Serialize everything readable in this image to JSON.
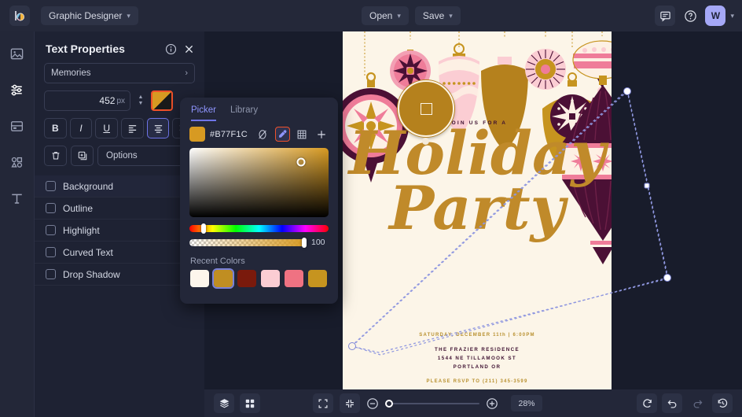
{
  "app": {
    "logo_icon": "color-wheel-logo",
    "document_name": "Graphic Designer"
  },
  "topbar": {
    "open_label": "Open",
    "save_label": "Save",
    "comment_icon": "comment-icon",
    "help_icon": "help-circle-icon",
    "avatar_initial": "W",
    "account_caret": "chevron-down-icon"
  },
  "rail": {
    "items": [
      {
        "icon": "image-icon",
        "name": "images"
      },
      {
        "icon": "sliders-icon",
        "name": "adjustments"
      },
      {
        "icon": "frame-icon",
        "name": "layouts"
      },
      {
        "icon": "shapes-icon",
        "name": "shapes"
      },
      {
        "icon": "text-icon",
        "name": "text"
      }
    ]
  },
  "panel": {
    "title": "Text Properties",
    "info_icon": "info-icon",
    "close_icon": "close-icon",
    "font_select": "Memories",
    "font_chevron": "chevron-right-icon",
    "size_value": "452",
    "size_unit": "px",
    "format_buttons": [
      {
        "label": "B",
        "name": "bold",
        "selected": false
      },
      {
        "label": "I",
        "name": "italic",
        "selected": false
      },
      {
        "label": "U",
        "name": "underline",
        "selected": false
      },
      {
        "label": "align-left",
        "name": "align-left",
        "selected": false
      },
      {
        "label": "align-center",
        "name": "align-center",
        "selected": true
      },
      {
        "label": "align-right",
        "name": "align-right",
        "selected": false
      }
    ],
    "delete_icon": "trash-icon",
    "duplicate_icon": "duplicate-icon",
    "options_label": "Options",
    "toggles": [
      {
        "label": "Background",
        "checked": false
      },
      {
        "label": "Outline",
        "checked": false
      },
      {
        "label": "Highlight",
        "checked": false
      },
      {
        "label": "Curved Text",
        "checked": false
      },
      {
        "label": "Drop Shadow",
        "checked": false
      }
    ]
  },
  "picker": {
    "tabs": [
      {
        "label": "Picker",
        "active": true
      },
      {
        "label": "Library",
        "active": false
      }
    ],
    "hex": "#B77F1C",
    "current_color": "#d79a22",
    "tools": [
      {
        "icon": "no-color-icon",
        "name": "no-color",
        "active": false
      },
      {
        "icon": "eyedropper-icon",
        "name": "eyedropper",
        "active": true
      },
      {
        "icon": "grid-icon",
        "name": "palette-grid",
        "active": false
      },
      {
        "icon": "plus-icon",
        "name": "add-color",
        "active": false
      }
    ],
    "alpha_value": "100",
    "recent_title": "Recent Colors",
    "recent_colors": [
      {
        "hex": "#fdf6ec",
        "selected": false
      },
      {
        "hex": "#c08e22",
        "selected": true
      },
      {
        "hex": "#7a1a0c",
        "selected": false
      },
      {
        "hex": "#fbcdd3",
        "selected": false
      },
      {
        "hex": "#ef7282",
        "selected": false
      },
      {
        "hex": "#c6941f",
        "selected": false
      }
    ]
  },
  "canvas": {
    "join_text": "JOIN US FOR A",
    "headline_line1": "Holiday",
    "headline_line2": "Party",
    "date_line": "SATURDAY, DECEMBER 11th | 6:00PM",
    "address_line1": "THE FRAZIER RESIDENCE",
    "address_line2": "1544 NE TILLAMOOK ST",
    "address_line3": "PORTLAND OR",
    "rsvp_line": "PLEASE RSVP TO (211) 345-3599",
    "magnifier_icon": "eyedropper-loupe"
  },
  "bottombar": {
    "layers_icon": "layers-icon",
    "grid_icon": "grid-view-icon",
    "fit_icon": "fit-screen-icon",
    "shrink_icon": "shrink-icon",
    "zoom_out_icon": "zoom-out-icon",
    "zoom_in_icon": "zoom-in-icon",
    "zoom_value": "28%",
    "reset_icon": "reset-icon",
    "undo_icon": "undo-icon",
    "redo_icon": "redo-icon",
    "history_icon": "history-icon"
  }
}
